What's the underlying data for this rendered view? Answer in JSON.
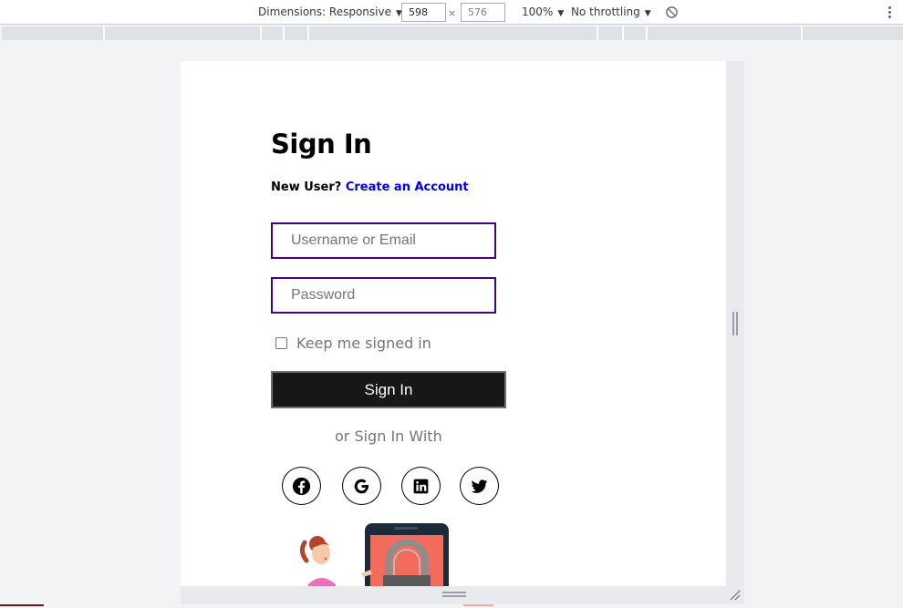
{
  "devtools": {
    "dimensions_label": "Dimensions: Responsive",
    "width": "598",
    "height": "576",
    "times": "×",
    "zoom": "100%",
    "throttling": "No throttling",
    "icons": [
      "rotate-icon",
      "more-options-icon"
    ]
  },
  "page": {
    "title": "Sign In",
    "new_user_text": "New User?",
    "create_account_link": "Create an Account",
    "username_placeholder": "Username or Email",
    "password_placeholder": "Password",
    "keep_signed_in": "Keep me signed in",
    "signin_button": "Sign In",
    "or_sign_in_with": "or Sign In With",
    "social_icons": [
      "facebook-icon",
      "google-icon",
      "linkedin-icon",
      "twitter-icon"
    ]
  },
  "colors": {
    "input_border": "#4b0082",
    "button_bg": "#181616",
    "link": "#0000ee"
  }
}
